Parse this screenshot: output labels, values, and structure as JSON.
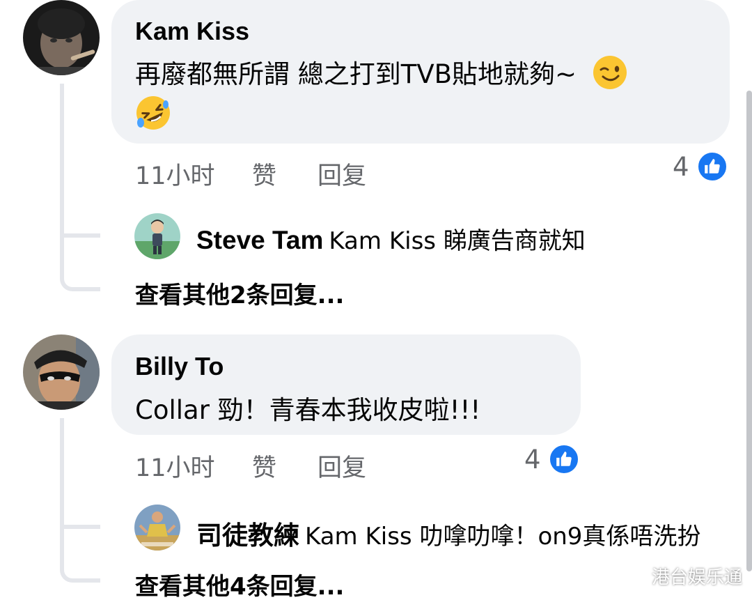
{
  "comments": [
    {
      "author": "Kam Kiss",
      "text_line1": "再廢都無所謂 總之打到TVB貼地就夠~",
      "emoji1": "wink-emoji",
      "emoji2": "rolling-laughing-emoji",
      "time": "11小时",
      "like_label": "赞",
      "reply_label": "回复",
      "like_count": "4",
      "reply": {
        "author": "Steve Tam",
        "text": "Kam Kiss 睇廣告商就知"
      },
      "more_replies": "查看其他2条回复..."
    },
    {
      "author": "Billy To",
      "text_line1": "Collar 勁！青春本我收皮啦!!!",
      "time": "11小时",
      "like_label": "赞",
      "reply_label": "回复",
      "like_count": "4",
      "reply": {
        "author": "司徒教練",
        "text": "Kam Kiss 叻嗱叻嗱！on9真係唔洗扮"
      },
      "more_replies": "查看其他4条回复..."
    }
  ],
  "watermark": "港台娱乐通",
  "colors": {
    "bubble": "#f0f2f5",
    "like_blue": "#1877f2",
    "meta_gray": "#65676b",
    "thread_line": "#e4e6eb"
  },
  "icons": [
    "like-thumb-icon",
    "wink-emoji",
    "rolling-laughing-emoji"
  ]
}
